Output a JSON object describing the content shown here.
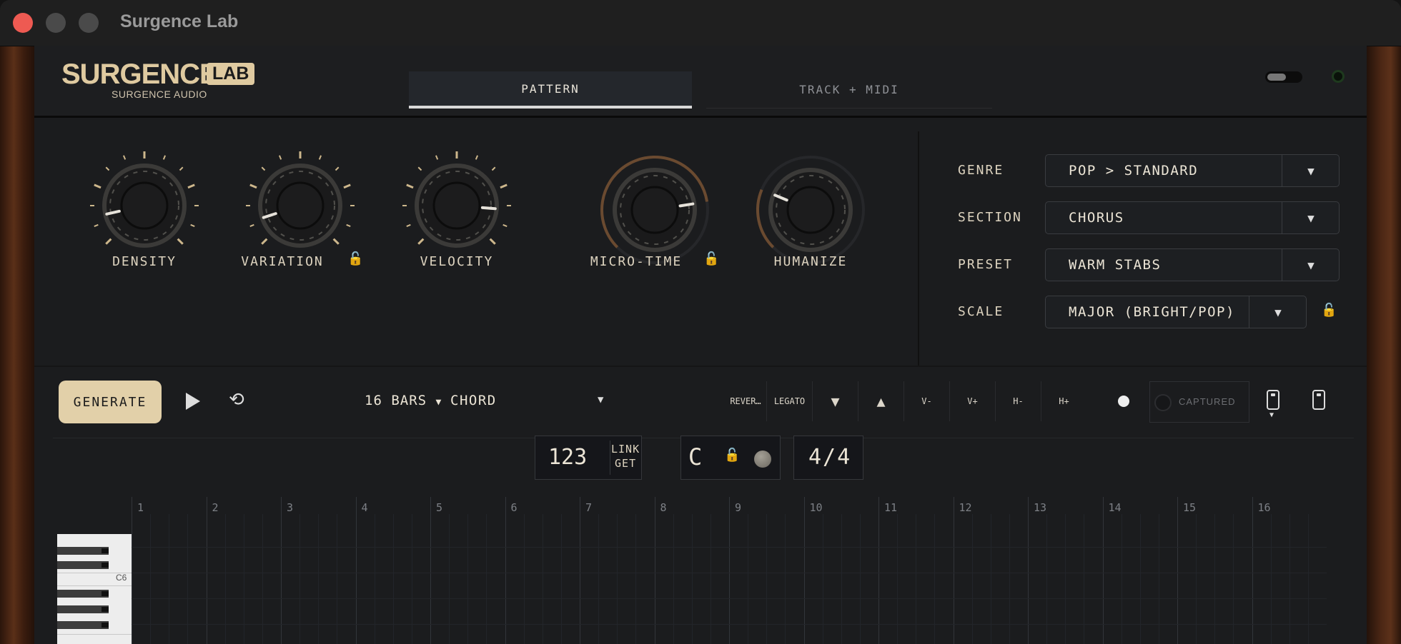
{
  "window": {
    "title": "Surgence Lab",
    "controls": [
      "close",
      "minimize",
      "zoom"
    ]
  },
  "brand": {
    "logo_main": "SURGENCE",
    "logo_badge": "LAB",
    "subtitle": "SURGENCE AUDIO",
    "accent_color": "#e2d0a9"
  },
  "tabs": [
    {
      "label": "PATTERN",
      "active": true
    },
    {
      "label": "TRACK + MIDI",
      "active": false
    }
  ],
  "knobs": [
    {
      "label": "DENSITY",
      "value": 0.12,
      "locked": false
    },
    {
      "label": "VARIATION",
      "value": 0.1,
      "locked": true
    },
    {
      "label": "VELOCITY",
      "value": 0.85,
      "locked": false
    },
    {
      "label": "MICRO-TIME",
      "value": 0.8,
      "locked": true
    },
    {
      "label": "HUMANIZE",
      "value": 0.25,
      "locked": false
    }
  ],
  "settings": [
    {
      "label": "GENRE",
      "value": "POP > STANDARD"
    },
    {
      "label": "SECTION",
      "value": "CHORUS"
    },
    {
      "label": "PRESET",
      "value": "WARM STABS"
    },
    {
      "label": "SCALE",
      "value": "MAJOR (BRIGHT/POP)",
      "locked": true
    }
  ],
  "toolbar": {
    "generate_label": "GENERATE",
    "bars_label": "16 BARS",
    "mode_label": "CHORD",
    "reverse_label": "REVER…",
    "legato_label": "LEGATO",
    "v_minus": "V-",
    "v_plus": "V+",
    "h_minus": "H-",
    "h_plus": "H+",
    "captured_label": "CAPTURED"
  },
  "transport": {
    "bpm": "123",
    "link_label": "LINK",
    "get_label": "GET",
    "key": "C",
    "time_signature": "4/4"
  },
  "piano_roll": {
    "bars": [
      "1",
      "2",
      "3",
      "4",
      "5",
      "6",
      "7",
      "8",
      "9",
      "10",
      "11",
      "12",
      "13",
      "14",
      "15",
      "16"
    ],
    "octave_label": "C6"
  }
}
